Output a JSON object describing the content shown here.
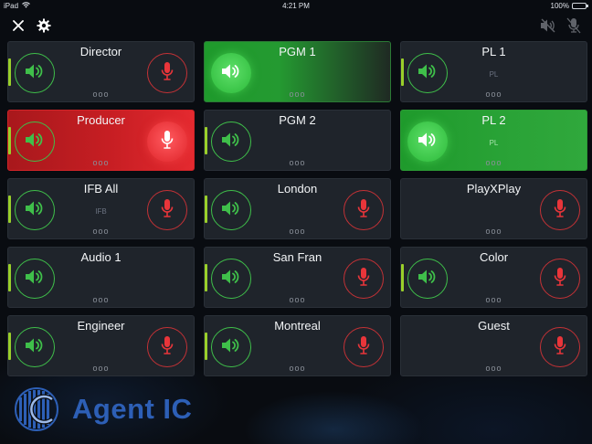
{
  "status_bar": {
    "device": "iPad",
    "time": "4:21 PM",
    "battery_percent": "100%"
  },
  "toolbar": {
    "close_icon": "close-icon",
    "settings_icon": "gear-icon",
    "speaker_muted_icon": "speaker-muted-icon",
    "mic_muted_icon": "mic-muted-icon"
  },
  "tiles": [
    {
      "name": "Director",
      "sub": "",
      "dots": "ooo"
    },
    {
      "name": "PGM 1",
      "sub": "",
      "dots": "ooo"
    },
    {
      "name": "PL 1",
      "sub": "PL",
      "dots": "ooo"
    },
    {
      "name": "Producer",
      "sub": "",
      "dots": "ooo"
    },
    {
      "name": "PGM 2",
      "sub": "",
      "dots": "ooo"
    },
    {
      "name": "PL 2",
      "sub": "PL",
      "dots": "ooo"
    },
    {
      "name": "IFB All",
      "sub": "IFB",
      "dots": "ooo"
    },
    {
      "name": "London",
      "sub": "",
      "dots": "ooo"
    },
    {
      "name": "PlayXPlay",
      "sub": "",
      "dots": "ooo"
    },
    {
      "name": "Audio 1",
      "sub": "",
      "dots": "ooo"
    },
    {
      "name": "San Fran",
      "sub": "",
      "dots": "ooo"
    },
    {
      "name": "Color",
      "sub": "",
      "dots": "ooo"
    },
    {
      "name": "Engineer",
      "sub": "",
      "dots": "ooo"
    },
    {
      "name": "Montreal",
      "sub": "",
      "dots": "ooo"
    },
    {
      "name": "Guest",
      "sub": "",
      "dots": "ooo"
    }
  ],
  "brand": {
    "name": "Agent IC",
    "color": "#2d5fb6"
  },
  "colors": {
    "listen_green": "#3fbf4a",
    "talk_red": "#e9353a",
    "level_bar": "#9ad02a"
  }
}
